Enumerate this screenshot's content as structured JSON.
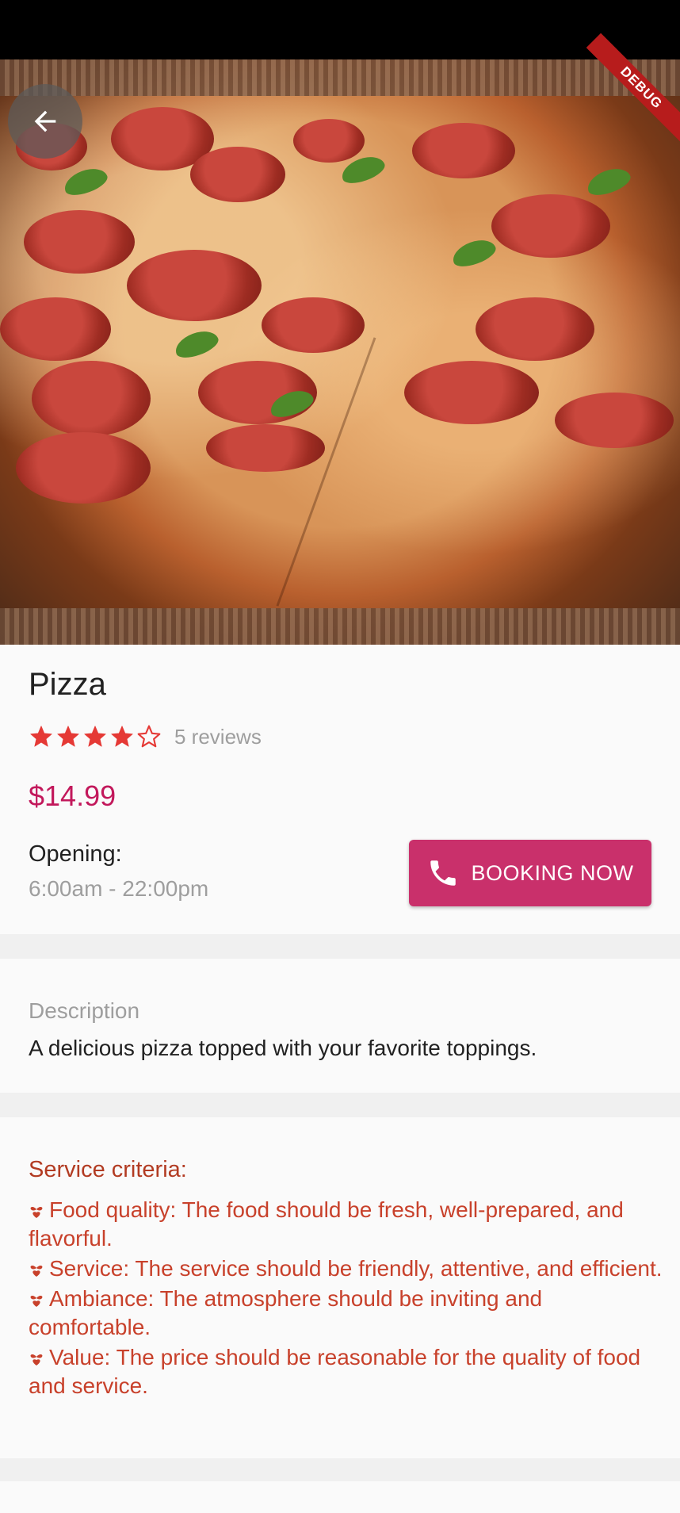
{
  "product": {
    "name": "Pizza",
    "rating": 4,
    "rating_max": 5,
    "reviews_label": "5 reviews",
    "price": "$14.99"
  },
  "opening": {
    "label": "Opening:",
    "hours": "6:00am - 22:00pm"
  },
  "booking_button": {
    "label": "BOOKING NOW",
    "icon": "phone-icon"
  },
  "description": {
    "heading": "Description",
    "text": "A delicious pizza topped with your favorite toppings."
  },
  "service_criteria": {
    "heading": "Service criteria:",
    "items": [
      "Food quality: The food should be fresh, well-prepared, and flavorful.",
      "Service: The service should be friendly, attentive, and efficient.",
      "Ambiance: The atmosphere should be inviting and comfortable.",
      "Value: The price should be reasonable for the quality of food and service."
    ]
  },
  "debug_banner": "DEBUG",
  "colors": {
    "accent": "#c9306b",
    "price": "#c2185b",
    "star": "#e53935",
    "criteria": "#c8412b",
    "muted": "#9e9e9e"
  }
}
